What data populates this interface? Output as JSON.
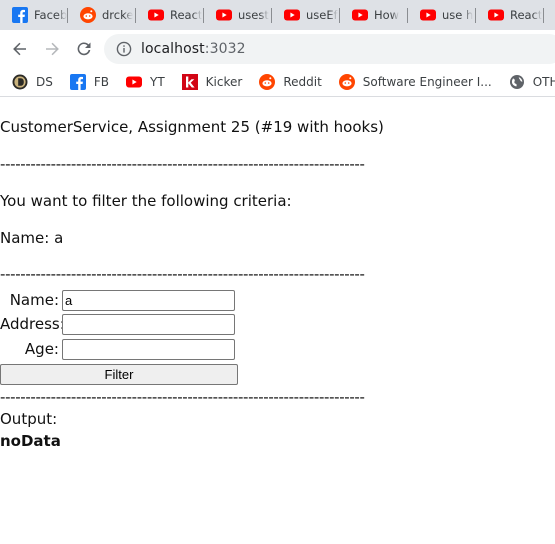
{
  "browser": {
    "tabs": [
      {
        "title": "Faceb",
        "icon": "facebook-icon"
      },
      {
        "title": "drcke",
        "icon": "reddit-icon"
      },
      {
        "title": "React",
        "icon": "youtube-icon"
      },
      {
        "title": "usest",
        "icon": "youtube-icon"
      },
      {
        "title": "useEf",
        "icon": "youtube-icon"
      },
      {
        "title": "How",
        "icon": "youtube-icon"
      },
      {
        "title": "use h",
        "icon": "youtube-icon"
      },
      {
        "title": "React",
        "icon": "youtube-icon"
      }
    ],
    "url_host": "localhost",
    "url_port": ":3032",
    "bookmarks": [
      {
        "label": "DS",
        "icon": "ds-icon"
      },
      {
        "label": "FB",
        "icon": "facebook-icon"
      },
      {
        "label": "YT",
        "icon": "youtube-icon"
      },
      {
        "label": "Kicker",
        "icon": "kicker-icon"
      },
      {
        "label": "Reddit",
        "icon": "reddit-icon"
      },
      {
        "label": "Software Engineer I...",
        "icon": "reddit-icon"
      },
      {
        "label": "OTH Webs",
        "icon": "globe-icon"
      }
    ],
    "colors": {
      "facebook": "#1877f2",
      "youtube": "#ff0000",
      "reddit": "#ff4500",
      "kicker": "#d20515"
    }
  },
  "page": {
    "title": "CustomerService, Assignment 25 (#19 with hooks)",
    "separator": "------------------------------------------------------------------------",
    "filter_intro": "You want to filter the following criteria:",
    "criteria_name": "Name: a",
    "form": {
      "name_label": "Name:",
      "name_value": "a",
      "address_label": "Address:",
      "address_value": "",
      "age_label": "Age:",
      "age_value": "",
      "filter_button": "Filter"
    },
    "output_label": "Output:",
    "output_value": "noData"
  }
}
